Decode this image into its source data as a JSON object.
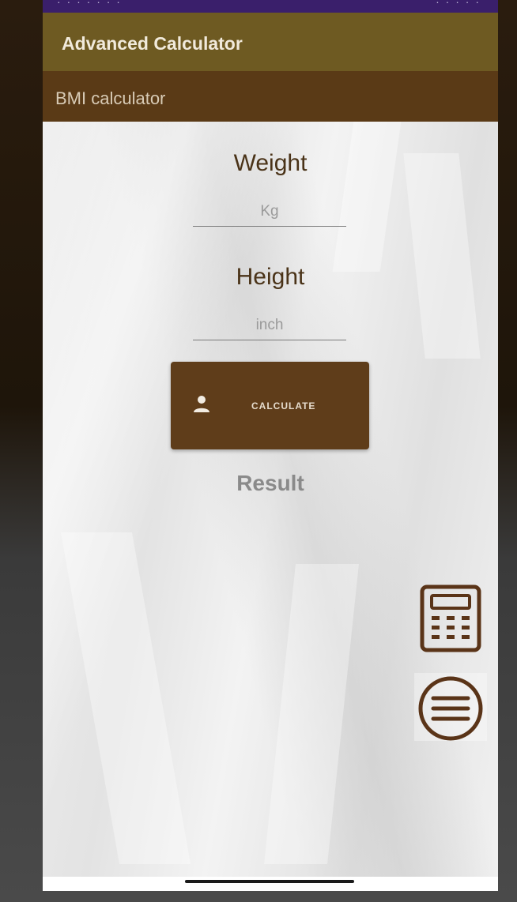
{
  "app_bar": {
    "title": "Advanced Calculator"
  },
  "sub_bar": {
    "title": "BMI calculator"
  },
  "weight": {
    "label": "Weight",
    "placeholder": "Kg"
  },
  "height": {
    "label": "Height",
    "placeholder": "inch"
  },
  "calculate_button": {
    "label": "CALCULATE",
    "icon": "person-icon"
  },
  "result": {
    "label": "Result"
  },
  "fabs": {
    "calculator_icon": "calculator-icon",
    "menu_icon": "menu-icon"
  },
  "colors": {
    "status_bar": "#3a1f6b",
    "app_bar": "#6e5a22",
    "sub_bar": "#5a3a16",
    "button": "#5f3d1a",
    "label_text": "#4a3318",
    "icon_brown": "#5a3418"
  }
}
